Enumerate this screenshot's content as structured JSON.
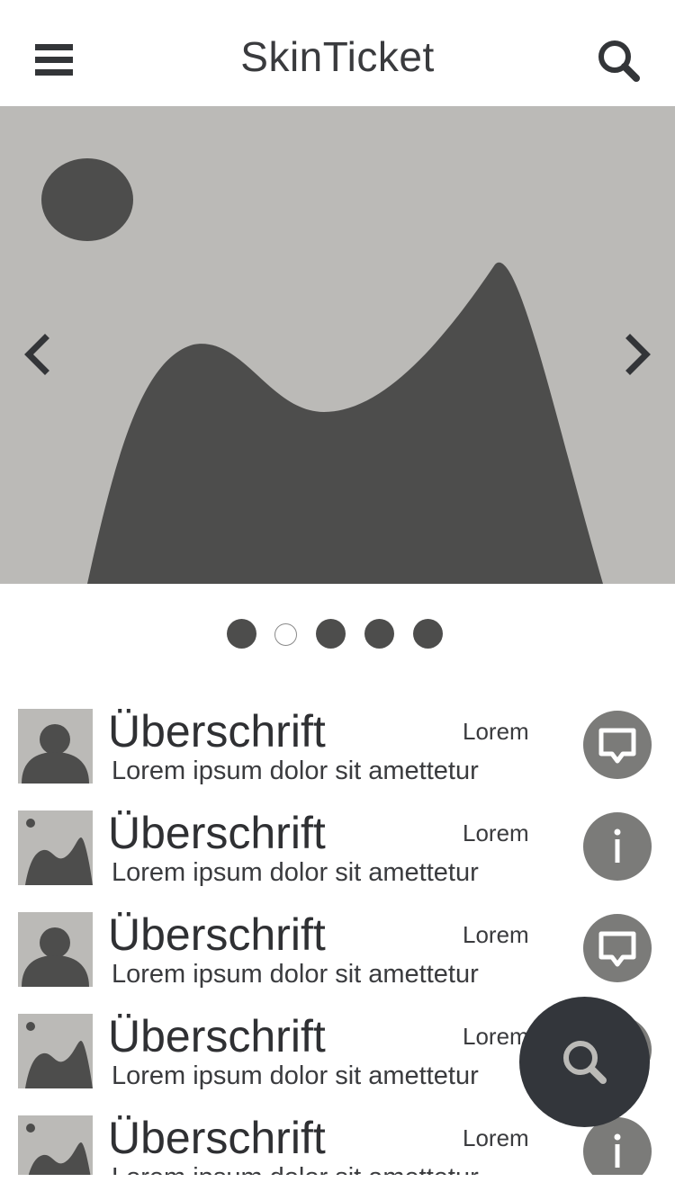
{
  "header": {
    "title": "SkinTicket",
    "menu_icon": "hamburger-menu-icon",
    "search_icon": "search-icon"
  },
  "carousel": {
    "image_icon": "image-placeholder-icon",
    "prev_icon": "chevron-left-icon",
    "next_icon": "chevron-right-icon",
    "slide_count": 5,
    "active_index": 1
  },
  "list": {
    "items": [
      {
        "title": "Überschrift",
        "meta": "Lorem",
        "subtitle": "Lorem ipsum dolor sit amettetur",
        "thumb": "person-placeholder-icon",
        "action": "chat-icon"
      },
      {
        "title": "Überschrift",
        "meta": "Lorem",
        "subtitle": "Lorem ipsum dolor sit amettetur",
        "thumb": "image-placeholder-icon",
        "action": "info-icon"
      },
      {
        "title": "Überschrift",
        "meta": "Lorem",
        "subtitle": "Lorem ipsum dolor sit amettetur",
        "thumb": "person-placeholder-icon",
        "action": "chat-icon"
      },
      {
        "title": "Überschrift",
        "meta": "Lorem",
        "subtitle": "Lorem ipsum dolor sit amettetur",
        "thumb": "image-placeholder-icon",
        "action": "info-icon"
      },
      {
        "title": "Überschrift",
        "meta": "Lorem",
        "subtitle": "Lorem ipsum dolor sit amettetur",
        "thumb": "image-placeholder-icon",
        "action": "info-icon"
      }
    ]
  },
  "fab": {
    "icon": "search-icon"
  },
  "colors": {
    "placeholder_bg": "#bbbab7",
    "placeholder_fg": "#4d4d4c",
    "action_bg": "#7b7b79",
    "fab_bg": "#33363b",
    "text": "#333538"
  }
}
